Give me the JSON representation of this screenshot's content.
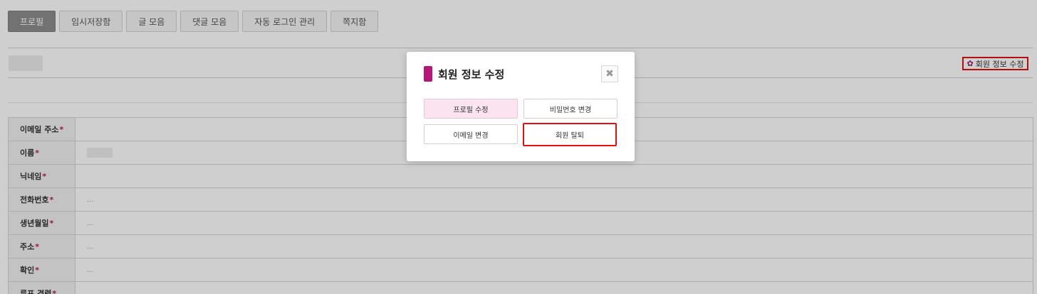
{
  "tabs": [
    {
      "label": "프로필",
      "active": true
    },
    {
      "label": "임시저장함"
    },
    {
      "label": "글 모음"
    },
    {
      "label": "댓글 모음"
    },
    {
      "label": "자동 로그인 관리"
    },
    {
      "label": "쪽지함"
    }
  ],
  "profile_header": {
    "edit_link_label": "회원 정보 수정",
    "edit_icon": "gear-icon"
  },
  "form": {
    "required_mark": "*",
    "rows": [
      {
        "label": "이메일 주소",
        "value": ""
      },
      {
        "label": "이름",
        "value": ""
      },
      {
        "label": "닉네임",
        "value": ""
      },
      {
        "label": "전화번호",
        "value": "..."
      },
      {
        "label": "생년월일",
        "value": "..."
      },
      {
        "label": "주소",
        "value": "..."
      },
      {
        "label": "확인",
        "value": "..."
      },
      {
        "label": "루프 경력",
        "value": ""
      }
    ]
  },
  "modal": {
    "title": "회원 정보 수정",
    "close_icon": "close-icon",
    "close_glyph": "✖",
    "buttons": {
      "profile_edit": "프로필 수정",
      "password_change": "비밀번호 변경",
      "email_change": "이메일 변경",
      "withdraw": "회원 탈퇴"
    }
  },
  "colors": {
    "accent": "#b8157a",
    "highlight": "#e01010",
    "active_tab": "#8d8d8d"
  }
}
